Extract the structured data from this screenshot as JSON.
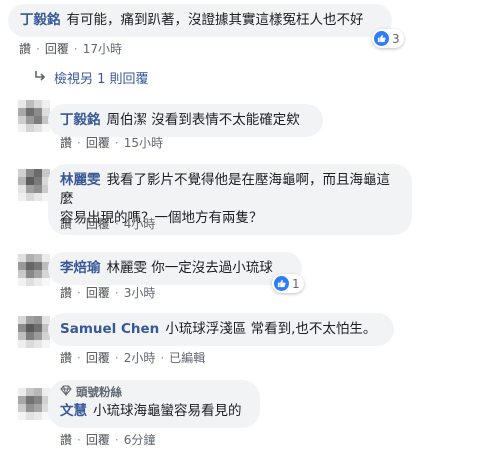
{
  "comments": [
    {
      "name": "丁毅銘",
      "text": "有可能，痛到趴著，沒證據其實這樣冤枉人也不好",
      "actions": [
        "讚",
        "回覆"
      ],
      "time": "17小時",
      "reaction_count": "3"
    },
    {
      "name": "丁毅銘",
      "text": "周伯潔 沒看到表情不太能確定欸",
      "actions": [
        "讚",
        "回覆"
      ],
      "time": "15小時"
    },
    {
      "name": "林麗雯",
      "text_line1": "我看了影片不覺得他是在壓海龜啊，而且海龜這麼",
      "text_line2": "容易出現的嗎？一個地方有兩隻？",
      "actions": [
        "讚",
        "回覆"
      ],
      "time": "4小時"
    },
    {
      "name": "李焙瑜",
      "text": "林麗雯 你一定沒去過小琉球",
      "actions": [
        "讚",
        "回覆"
      ],
      "time": "3小時",
      "reaction_count": "1"
    },
    {
      "name": "Samuel Chen",
      "text": "小琉球浮淺區 常看到,也不太怕生。",
      "actions": [
        "讚",
        "回覆"
      ],
      "time": "2小時",
      "edited": "已編輯"
    },
    {
      "badge": "頭號粉絲",
      "name": "文慧",
      "text": "小琉球海龜蠻容易看見的",
      "actions": [
        "讚",
        "回覆"
      ],
      "time": "6分鐘"
    }
  ],
  "view_more": "檢視另 1 則回覆",
  "colors": {
    "name": "#385898",
    "bubble": "#f2f3f5",
    "like": "#2f7df6"
  },
  "icons": [
    "reply-arrow-icon",
    "like-icon",
    "diamond-badge-icon"
  ]
}
